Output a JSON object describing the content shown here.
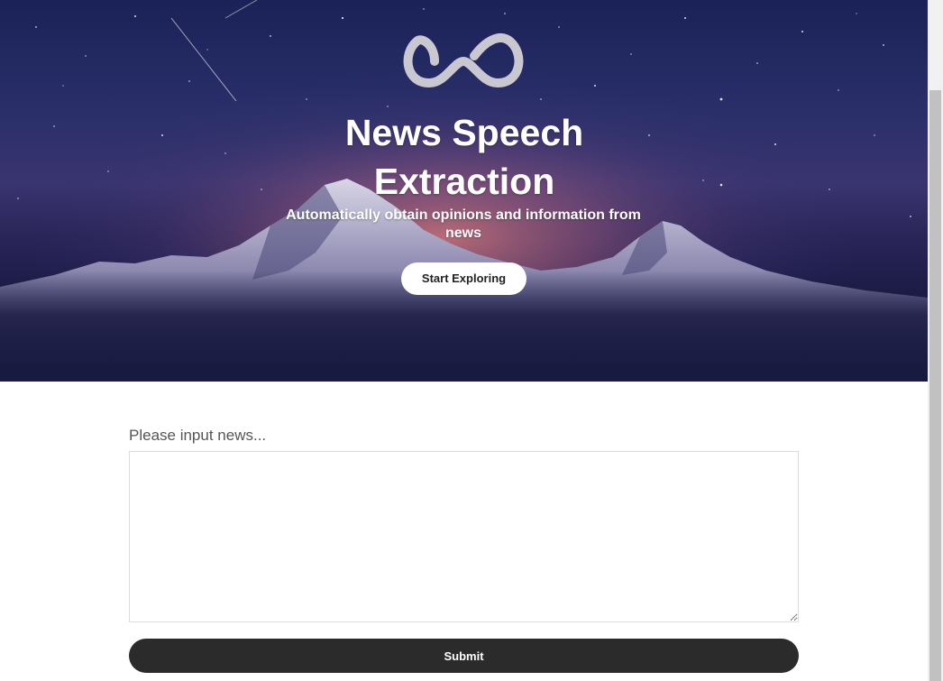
{
  "hero": {
    "title": "News Speech Extraction",
    "subtitle": "Automatically obtain opinions and information from news",
    "cta_label": "Start Exploring",
    "logo_icon": "infinity-icon",
    "background": "starry-night-mountain"
  },
  "form": {
    "label": "Please input news...",
    "textarea_value": "",
    "submit_label": "Submit"
  },
  "colors": {
    "hero_top": "#1b2257",
    "hero_glow": "#b0677a",
    "hero_bottom": "#151838",
    "submit_bg": "#2b2b2b",
    "cta_bg": "#ffffff",
    "logo": "#c9c8d0"
  }
}
